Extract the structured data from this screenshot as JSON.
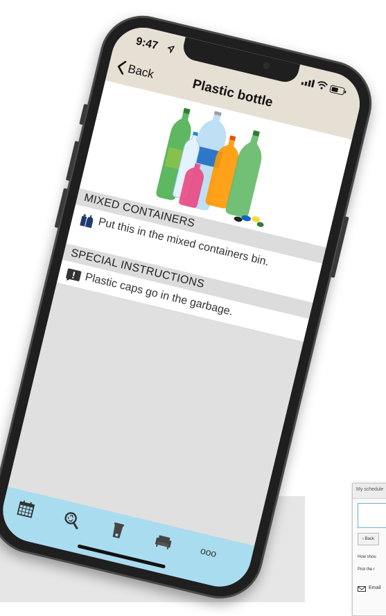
{
  "status_bar": {
    "time": "9:47"
  },
  "nav": {
    "back_label": "Back",
    "title": "Plastic bottle"
  },
  "item": {
    "image": "plastic-bottles-photo",
    "sections": [
      {
        "header": "MIXED CONTAINERS",
        "icon": "mixed-containers-icon",
        "text": "Put this in the mixed containers bin."
      },
      {
        "header": "SPECIAL INSTRUCTIONS",
        "icon": "alert-icon",
        "text": "Plastic caps go in the garbage."
      }
    ]
  },
  "tabbar": {
    "tabs": [
      "calendar-icon",
      "search-recycle-icon",
      "bin-icon",
      "bulky-item-icon",
      "more-icon"
    ],
    "more_label": "ooo"
  },
  "background_card": {
    "header": "My schedule",
    "back_label": "Back",
    "line1": "How shou",
    "line2": "Pick the r",
    "email_label": "Email"
  },
  "colors": {
    "nav_bg": "#e6dfd3",
    "tabbar_bg": "#a9dcef",
    "section_header_bg": "#dcdcdc",
    "icon_navy": "#1f3a6e"
  }
}
